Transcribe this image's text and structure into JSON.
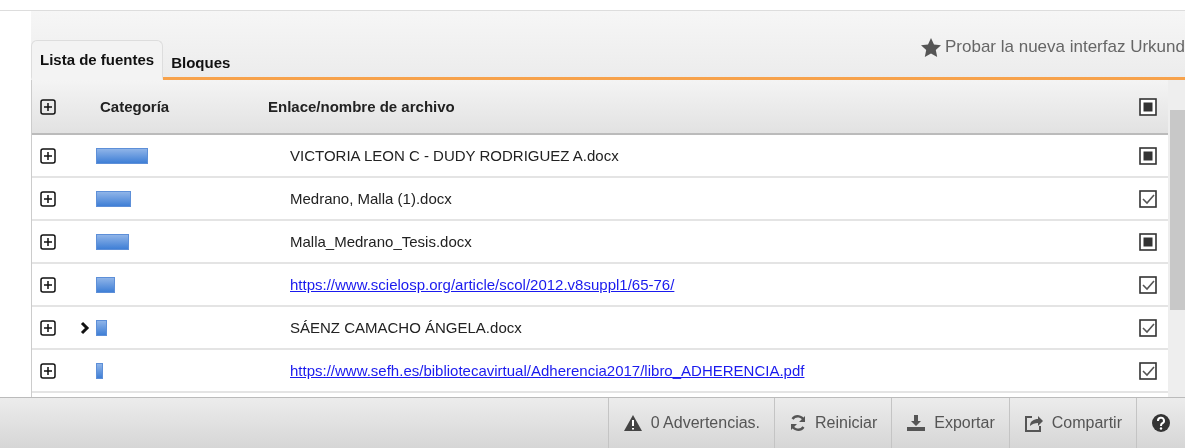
{
  "tabs": [
    {
      "label": "Lista de fuentes",
      "selected": true
    },
    {
      "label": "Bloques",
      "selected": false
    }
  ],
  "promo_link": "Probar la nueva interfaz Urkund",
  "table": {
    "columns": [
      "Categoría",
      "Enlace/nombre de archivo"
    ],
    "header_checked": false,
    "rows": [
      {
        "pointer": false,
        "kind": "file",
        "name": "VICTORIA LEON C - DUDY RODRIGUEZ A.docx",
        "checked": false
      },
      {
        "pointer": false,
        "kind": "file",
        "name": "Medrano, Malla (1).docx",
        "checked": true
      },
      {
        "pointer": false,
        "kind": "file",
        "name": "Malla_Medrano_Tesis.docx",
        "checked": false
      },
      {
        "pointer": false,
        "kind": "link",
        "name": "https://www.scielosp.org/article/scol/2012.v8suppl1/65-76/",
        "checked": true
      },
      {
        "pointer": true,
        "kind": "file",
        "name": "SÁENZ CAMACHO ÁNGELA.docx",
        "checked": true
      },
      {
        "pointer": false,
        "kind": "link",
        "name": "https://www.sefh.es/bibliotecavirtual/Adherencia2017/libro_ADHERENCIA.pdf",
        "checked": true
      }
    ]
  },
  "toolbar": [
    {
      "kind": "warning",
      "label": "0 Advertencias."
    },
    {
      "kind": "reset",
      "label": "Reiniciar"
    },
    {
      "kind": "export",
      "label": "Exportar"
    },
    {
      "kind": "share",
      "label": "Compartir"
    },
    {
      "kind": "help"
    }
  ]
}
